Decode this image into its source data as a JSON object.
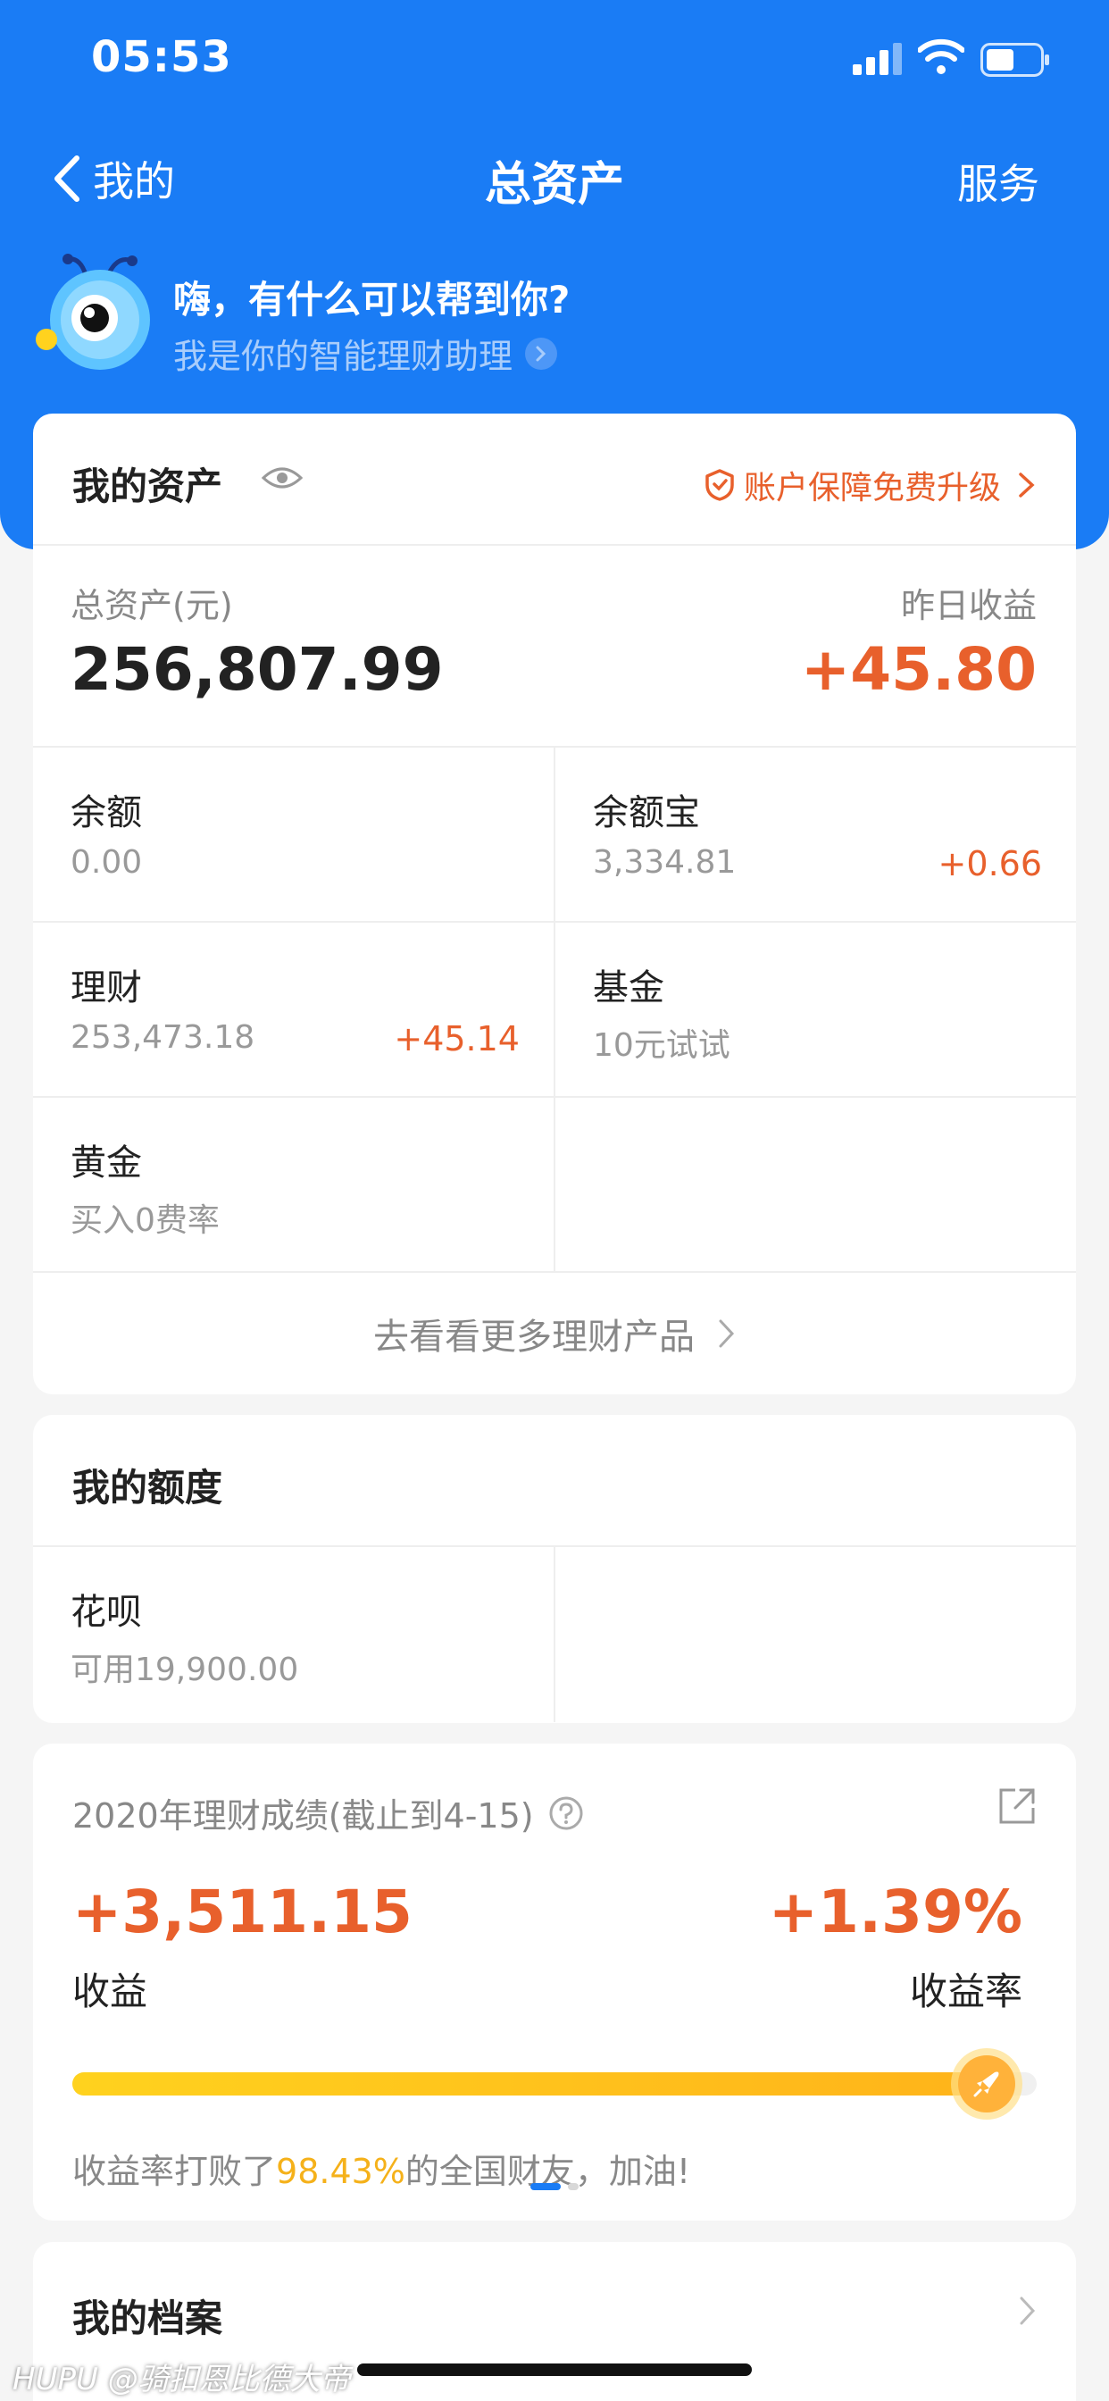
{
  "status_bar": {
    "time": "05:53"
  },
  "nav": {
    "back_label": "我的",
    "title": "总资产",
    "service_label": "服务"
  },
  "assistant": {
    "greeting": "嗨，有什么可以帮到你?",
    "subtitle": "我是你的智能理财助理"
  },
  "assets": {
    "title": "我的资产",
    "protect_label": "账户保障免费升级",
    "total_label": "总资产(元)",
    "total_value": "256,807.99",
    "yesterday_label": "昨日收益",
    "yesterday_value": "+45.80",
    "items": [
      {
        "title": "余额",
        "value": "0.00",
        "gain": ""
      },
      {
        "title": "余额宝",
        "value": "3,334.81",
        "gain": "+0.66"
      },
      {
        "title": "理财",
        "value": "253,473.18",
        "gain": "+45.14"
      },
      {
        "title": "基金",
        "value": "10元试试",
        "gain": ""
      },
      {
        "title": "黄金",
        "value": "买入0费率",
        "gain": ""
      }
    ],
    "more_label": "去看看更多理财产品"
  },
  "quota": {
    "title": "我的额度",
    "items": [
      {
        "title": "花呗",
        "value": "可用19,900.00"
      }
    ]
  },
  "performance": {
    "title": "2020年理财成绩(截止到4-15)",
    "gain_value": "+3,511.15",
    "gain_label": "收益",
    "rate_value": "+1.39%",
    "rate_label": "收益率",
    "progress_fraction": 0.9843,
    "beat_prefix": "收益率打败了",
    "beat_percent": "98.43%",
    "beat_suffix": "的全国财友，加油!"
  },
  "profile": {
    "title": "我的档案"
  },
  "watermark": "HUPU @骑扣恩比德大帝",
  "colors": {
    "brand_blue": "#1a7cf5",
    "gain_orange": "#e8602c",
    "progress_yellow": "#ffc41e"
  }
}
